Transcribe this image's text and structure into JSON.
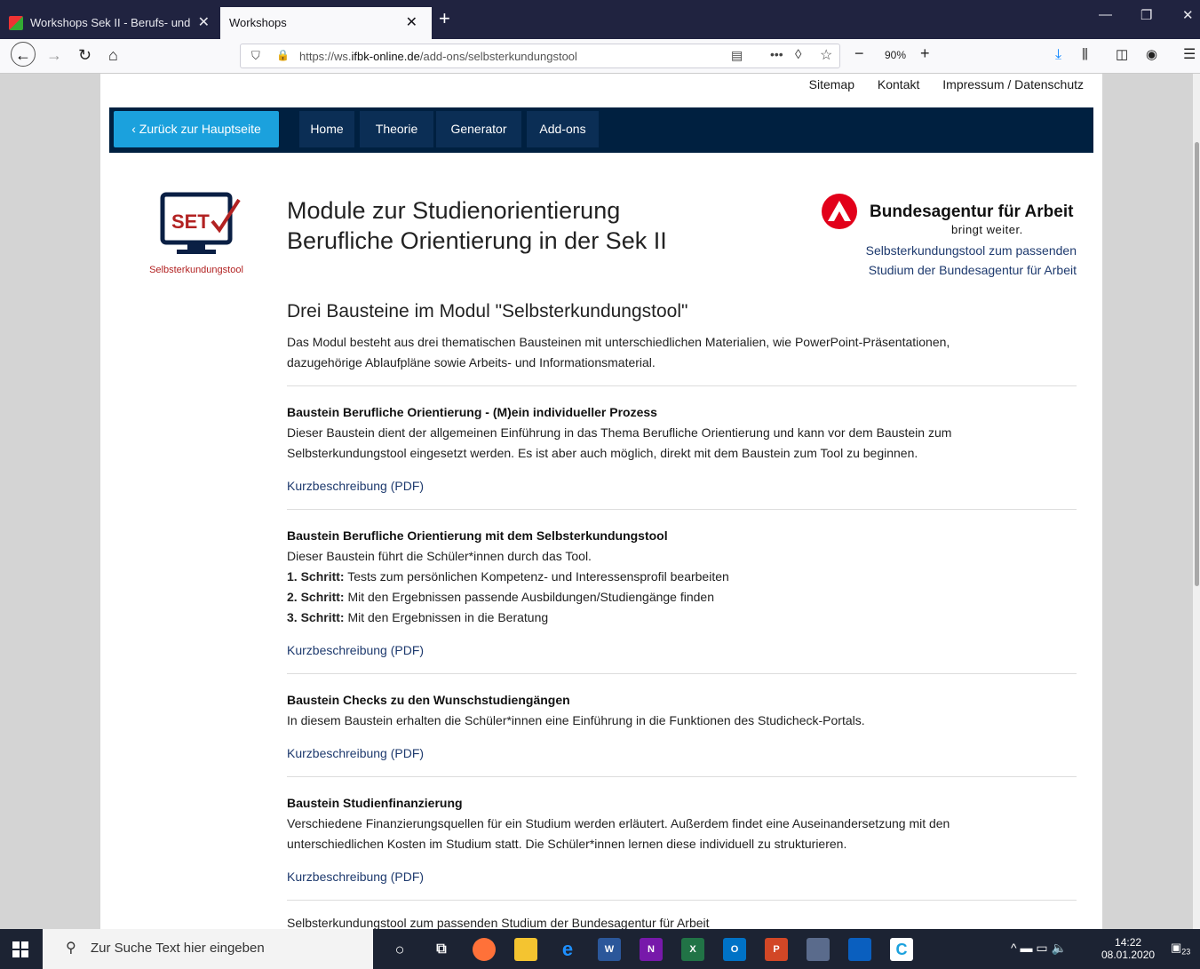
{
  "browser": {
    "tabs": [
      {
        "title": "Workshops Sek II - Berufs- und"
      },
      {
        "title": "Workshops"
      }
    ],
    "url_prefix": "https://ws.",
    "url_domain": "ifbk-online.de",
    "url_path": "/add-ons/selbsterkundungstool",
    "zoom": "90%"
  },
  "top_links": [
    "Sitemap",
    "Kontakt",
    "Impressum / Datenschutz"
  ],
  "nav": {
    "back_label": "‹  Zurück zur Hauptseite",
    "items": [
      "Home",
      "Theorie",
      "Generator",
      "Add-ons"
    ]
  },
  "logo": {
    "text": "SET",
    "caption": "Selbsterkundungstool"
  },
  "header": {
    "title_line1": "Module zur Studienorientierung",
    "title_line2": "Berufliche Orientierung in der Sek II"
  },
  "partner": {
    "name": "Bundesagentur für Arbeit",
    "tagline": "bringt weiter.",
    "link_line1": "Selbsterkundungstool zum passenden",
    "link_line2": "Studium der Bundesagentur für Arbeit"
  },
  "intro": {
    "heading": "Drei Bausteine im Modul \"Selbsterkundungstool\"",
    "text_line1": "Das Modul besteht aus drei thematischen Bausteinen mit unterschiedlichen Materialien, wie PowerPoint-Präsentationen,",
    "text_line2": "dazugehörige Ablaufpläne sowie Arbeits- und Informationsmaterial."
  },
  "sections": [
    {
      "heading": "Baustein Berufliche Orientierung - (M)ein individueller Prozess",
      "line1": "Dieser Baustein dient der allgemeinen Einführung in das Thema Berufliche Orientierung und kann vor dem Baustein zum",
      "line2": "Selbsterkundungstool eingesetzt werden. Es ist aber auch möglich, direkt mit dem Baustein zum Tool zu beginnen.",
      "link": "Kurzbeschreibung (PDF)"
    },
    {
      "heading": "Baustein Berufliche Orientierung mit dem Selbsterkundungstool",
      "line1": "Dieser Baustein führt die Schüler*innen durch das Tool.",
      "steps": [
        {
          "label": "1. Schritt:",
          "text": " Tests zum persönlichen Kompetenz- und Interessensprofil bearbeiten"
        },
        {
          "label": "2. Schritt:",
          "text": " Mit den Ergebnissen passende Ausbildungen/Studiengänge finden"
        },
        {
          "label": "3. Schritt:",
          "text": " Mit den Ergebnissen in die Beratung"
        }
      ],
      "link": "Kurzbeschreibung (PDF)"
    },
    {
      "heading": "Baustein Checks zu den Wunschstudiengängen",
      "line1": "In diesem Baustein erhalten die Schüler*innen eine Einführung in die Funktionen des Studicheck-Portals.",
      "link": "Kurzbeschreibung (PDF)"
    },
    {
      "heading": "Baustein Studienfinanzierung",
      "line1": "Verschiedene Finanzierungsquellen für ein Studium werden erläutert. Außerdem findet eine Auseinandersetzung mit den",
      "line2": "unterschiedlichen Kosten im Studium statt. Die Schüler*innen lernen diese individuell zu strukturieren.",
      "link": "Kurzbeschreibung (PDF)"
    }
  ],
  "footer_link": "Selbsterkundungstool zum passenden Studium der Bundesagentur für Arbeit",
  "taskbar": {
    "search_placeholder": "Zur Suche Text hier eingeben",
    "time": "14:22",
    "date": "08.01.2020",
    "notifications": "23"
  }
}
